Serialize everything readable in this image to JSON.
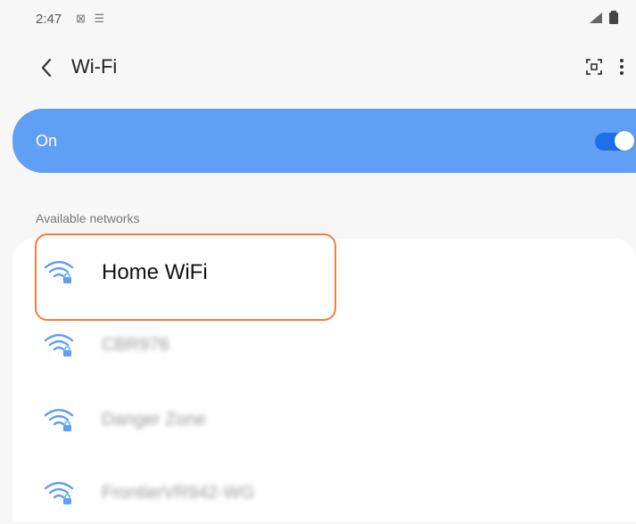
{
  "status_bar": {
    "time": "2:47",
    "left_icons": "⊠ ☰",
    "right_icons": [
      "signal-icon",
      "battery-icon"
    ]
  },
  "toolbar": {
    "back_icon": "chevron-left-icon",
    "title": "Wi-Fi",
    "qr_icon": "qr-scan-icon",
    "more_icon": "more-vertical-icon"
  },
  "master_switch": {
    "label": "On",
    "enabled": true
  },
  "section": {
    "label": "Available networks"
  },
  "networks": [
    {
      "name": "Home WiFi",
      "secured": true,
      "icon": "wifi-lock-icon"
    },
    {
      "name": "CBR976",
      "secured": true,
      "icon": "wifi-lock-icon"
    },
    {
      "name": "Danger Zone",
      "secured": true,
      "icon": "wifi-lock-icon"
    },
    {
      "name": "FrontierVR942-WG",
      "secured": true,
      "icon": "wifi-lock-icon"
    }
  ],
  "colors": {
    "accent": "#5f9ff4",
    "toggle_track": "#1f6ee8",
    "highlight_outline": "#f07f3a"
  }
}
